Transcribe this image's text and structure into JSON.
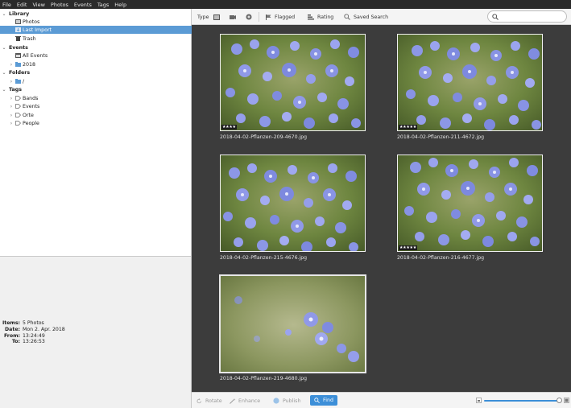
{
  "menubar": {
    "items": [
      "File",
      "Edit",
      "View",
      "Photos",
      "Events",
      "Tags",
      "Help"
    ]
  },
  "sidebar": {
    "library_header": "Library",
    "library_items": [
      "Photos",
      "Last Import",
      "Trash"
    ],
    "events_header": "Events",
    "events_items": [
      "All Events",
      "2018"
    ],
    "folders_header": "Folders",
    "folders_items": [
      "/"
    ],
    "tags_header": "Tags",
    "tags_items": [
      "Bands",
      "Events",
      "Orte",
      "People"
    ],
    "selected": "Last Import"
  },
  "info": {
    "items_key": "Items:",
    "items_val": "5 Photos",
    "date_key": "Date:",
    "date_val": "Mon 2. Apr. 2018",
    "from_key": "From:",
    "from_val": "13:24:49",
    "to_key": "To:",
    "to_val": "13:26:53"
  },
  "toolbar": {
    "type_label": "Type",
    "flagged_label": "Flagged",
    "rating_label": "Rating",
    "saved_search_label": "Saved Search",
    "search_placeholder": ""
  },
  "photos": [
    {
      "filename": "2018-04-02-Pflanzen-209-4670.jpg",
      "rating": "★★★★",
      "stars": 4
    },
    {
      "filename": "2018-04-02-Pflanzen-211-4672.jpg",
      "rating": "★★★★★",
      "stars": 5
    },
    {
      "filename": "2018-04-02-Pflanzen-215-4676.jpg",
      "rating": "",
      "stars": 0
    },
    {
      "filename": "2018-04-02-Pflanzen-216-4677.jpg",
      "rating": "★★★★★",
      "stars": 5
    },
    {
      "filename": "2018-04-02-Pflanzen-219-4680.jpg",
      "rating": "",
      "stars": 0
    }
  ],
  "bottombar": {
    "rotate_label": "Rotate",
    "enhance_label": "Enhance",
    "publish_label": "Publish",
    "find_label": "Find",
    "zoom_level": 0.96
  },
  "colors": {
    "accent": "#3d8fd8",
    "selection": "#5b9bd5",
    "grid_background": "#3c3c3c"
  }
}
